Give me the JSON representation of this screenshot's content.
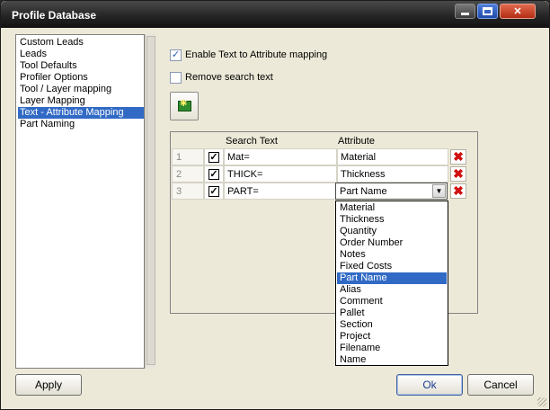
{
  "window": {
    "title": "Profile Database"
  },
  "left_list": {
    "items": [
      {
        "label": "Custom Leads",
        "selected": false
      },
      {
        "label": "Leads",
        "selected": false
      },
      {
        "label": "Tool Defaults",
        "selected": false
      },
      {
        "label": "Profiler Options",
        "selected": false
      },
      {
        "label": "Tool / Layer mapping",
        "selected": false
      },
      {
        "label": "Layer Mapping",
        "selected": false
      },
      {
        "label": "Text - Attribute Mapping",
        "selected": true
      },
      {
        "label": "Part Naming",
        "selected": false
      }
    ]
  },
  "options": {
    "enable_mapping": {
      "label": "Enable Text to Attribute mapping",
      "checked": true
    },
    "remove_search": {
      "label": "Remove search text",
      "checked": false
    }
  },
  "add_button_icon": "add-row-icon",
  "grid": {
    "headers": {
      "search": "Search Text",
      "attribute": "Attribute"
    },
    "rows": [
      {
        "num": "1",
        "checked": true,
        "search": "Mat=",
        "attribute": "Material"
      },
      {
        "num": "2",
        "checked": true,
        "search": "THICK=",
        "attribute": "Thickness"
      },
      {
        "num": "3",
        "checked": true,
        "search": "PART=",
        "attribute": "Part Name"
      }
    ],
    "delete_icon": "red-x-icon"
  },
  "dropdown": {
    "selected": "Part Name",
    "options": [
      "Material",
      "Thickness",
      "Quantity",
      "Order Number",
      "Notes",
      "Fixed Costs",
      "Part Name",
      "Alias",
      "Comment",
      "Pallet",
      "Section",
      "Project",
      "Filename",
      "Name"
    ]
  },
  "buttons": {
    "apply": "Apply",
    "ok": "Ok",
    "cancel": "Cancel"
  },
  "colors": {
    "selection": "#316ac5",
    "dialog_bg": "#ece9d8",
    "delete_red": "#d01010"
  }
}
